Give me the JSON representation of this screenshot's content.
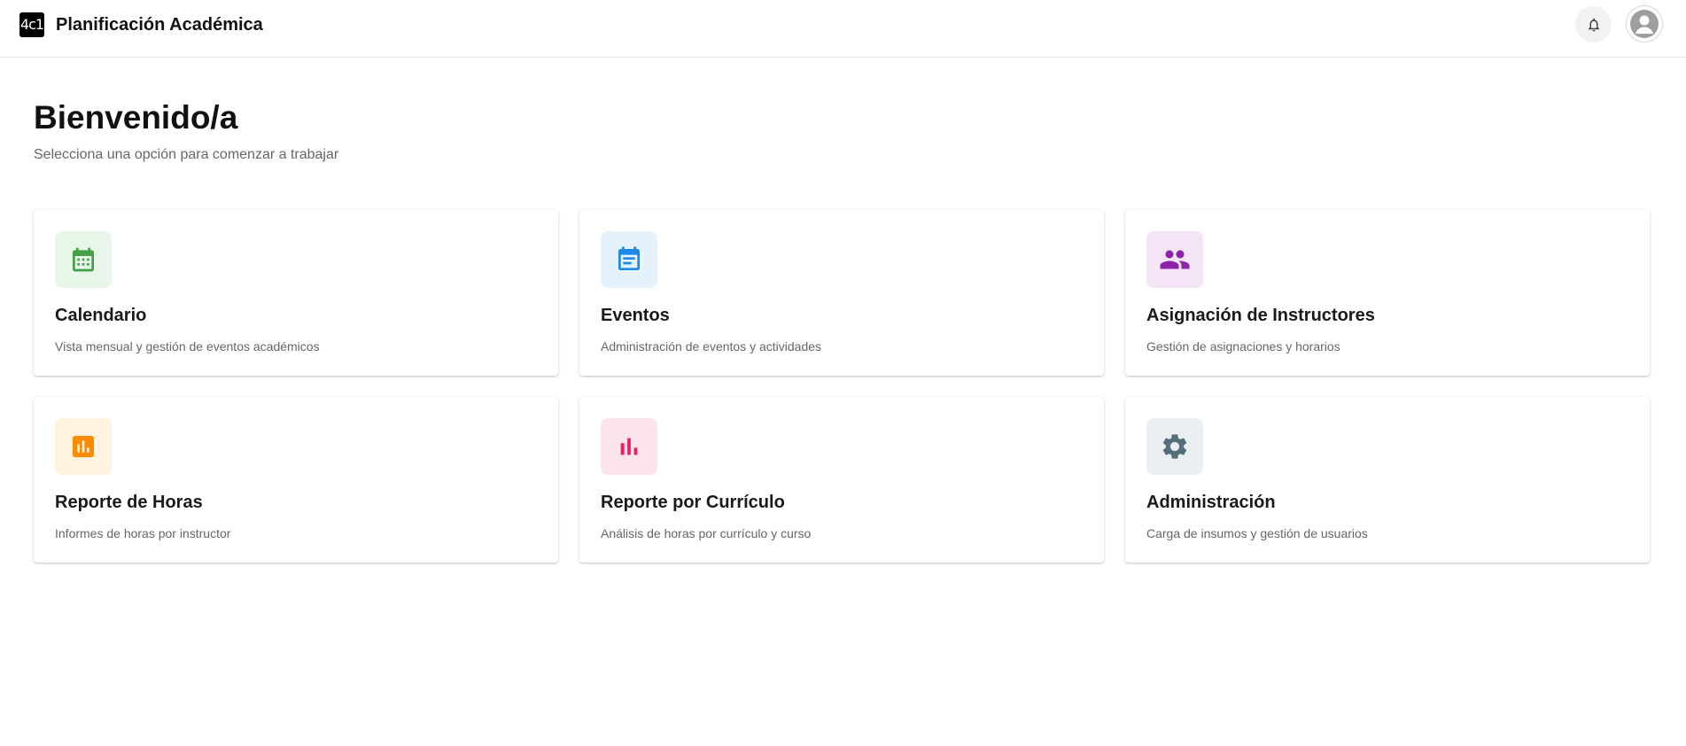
{
  "header": {
    "logo_text": "4c1",
    "app_title": "Planificación Académica",
    "icons": [
      "bell-icon",
      "user-avatar-icon"
    ]
  },
  "welcome": {
    "title": "Bienvenido/a",
    "subtitle": "Selecciona una opción para comenzar a trabajar"
  },
  "cards": [
    {
      "title": "Calendario",
      "description": "Vista mensual y gestión de eventos académicos",
      "icon": "calendar-icon",
      "color": "#43a047",
      "bg": "#e8f5e9"
    },
    {
      "title": "Eventos",
      "description": "Administración de eventos y actividades",
      "icon": "event-note-icon",
      "color": "#1e88e5",
      "bg": "#e3f2fd"
    },
    {
      "title": "Asignación de Instructores",
      "description": "Gestión de asignaciones y horarios",
      "icon": "people-icon",
      "color": "#8e24aa",
      "bg": "#f3e5f5"
    },
    {
      "title": "Reporte de Horas",
      "description": "Informes de horas por instructor",
      "icon": "assessment-icon",
      "color": "#fb8c00",
      "bg": "#fff3e0"
    },
    {
      "title": "Reporte por Currículo",
      "description": "Análisis de horas por currículo y curso",
      "icon": "bar-chart-icon",
      "color": "#e91e63",
      "bg": "#fce4ec"
    },
    {
      "title": "Administración",
      "description": "Carga de insumos y gestión de usuarios",
      "icon": "gear-icon",
      "color": "#546e7a",
      "bg": "#eceff1"
    }
  ]
}
